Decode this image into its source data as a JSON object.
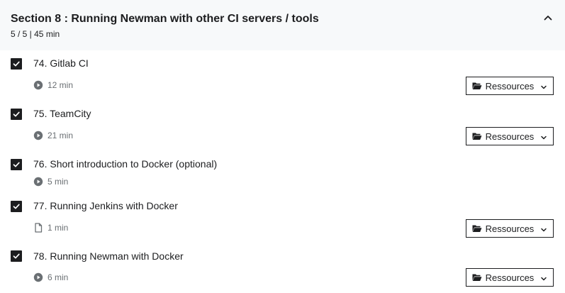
{
  "section": {
    "title": "Section 8 : Running Newman with other CI servers / tools",
    "meta": "5 / 5 | 45 min"
  },
  "lectures": [
    {
      "title": "74. Gitlab CI",
      "duration": "12 min",
      "type": "video",
      "has_resources": true,
      "resources_label": "Ressources"
    },
    {
      "title": "75. TeamCity",
      "duration": "21 min",
      "type": "video",
      "has_resources": true,
      "resources_label": "Ressources"
    },
    {
      "title": "76. Short introduction to Docker (optional)",
      "duration": "5 min",
      "type": "video",
      "has_resources": false
    },
    {
      "title": "77. Running Jenkins with Docker",
      "duration": "1 min",
      "type": "article",
      "has_resources": true,
      "resources_label": "Ressources"
    },
    {
      "title": "78. Running Newman with Docker",
      "duration": "6 min",
      "type": "video",
      "has_resources": true,
      "resources_label": "Ressources"
    }
  ],
  "colors": {
    "header_bg": "#f7f9fa",
    "text": "#1c1d1f",
    "muted": "#6a6f73",
    "checkbox": "#1c1d1f"
  }
}
